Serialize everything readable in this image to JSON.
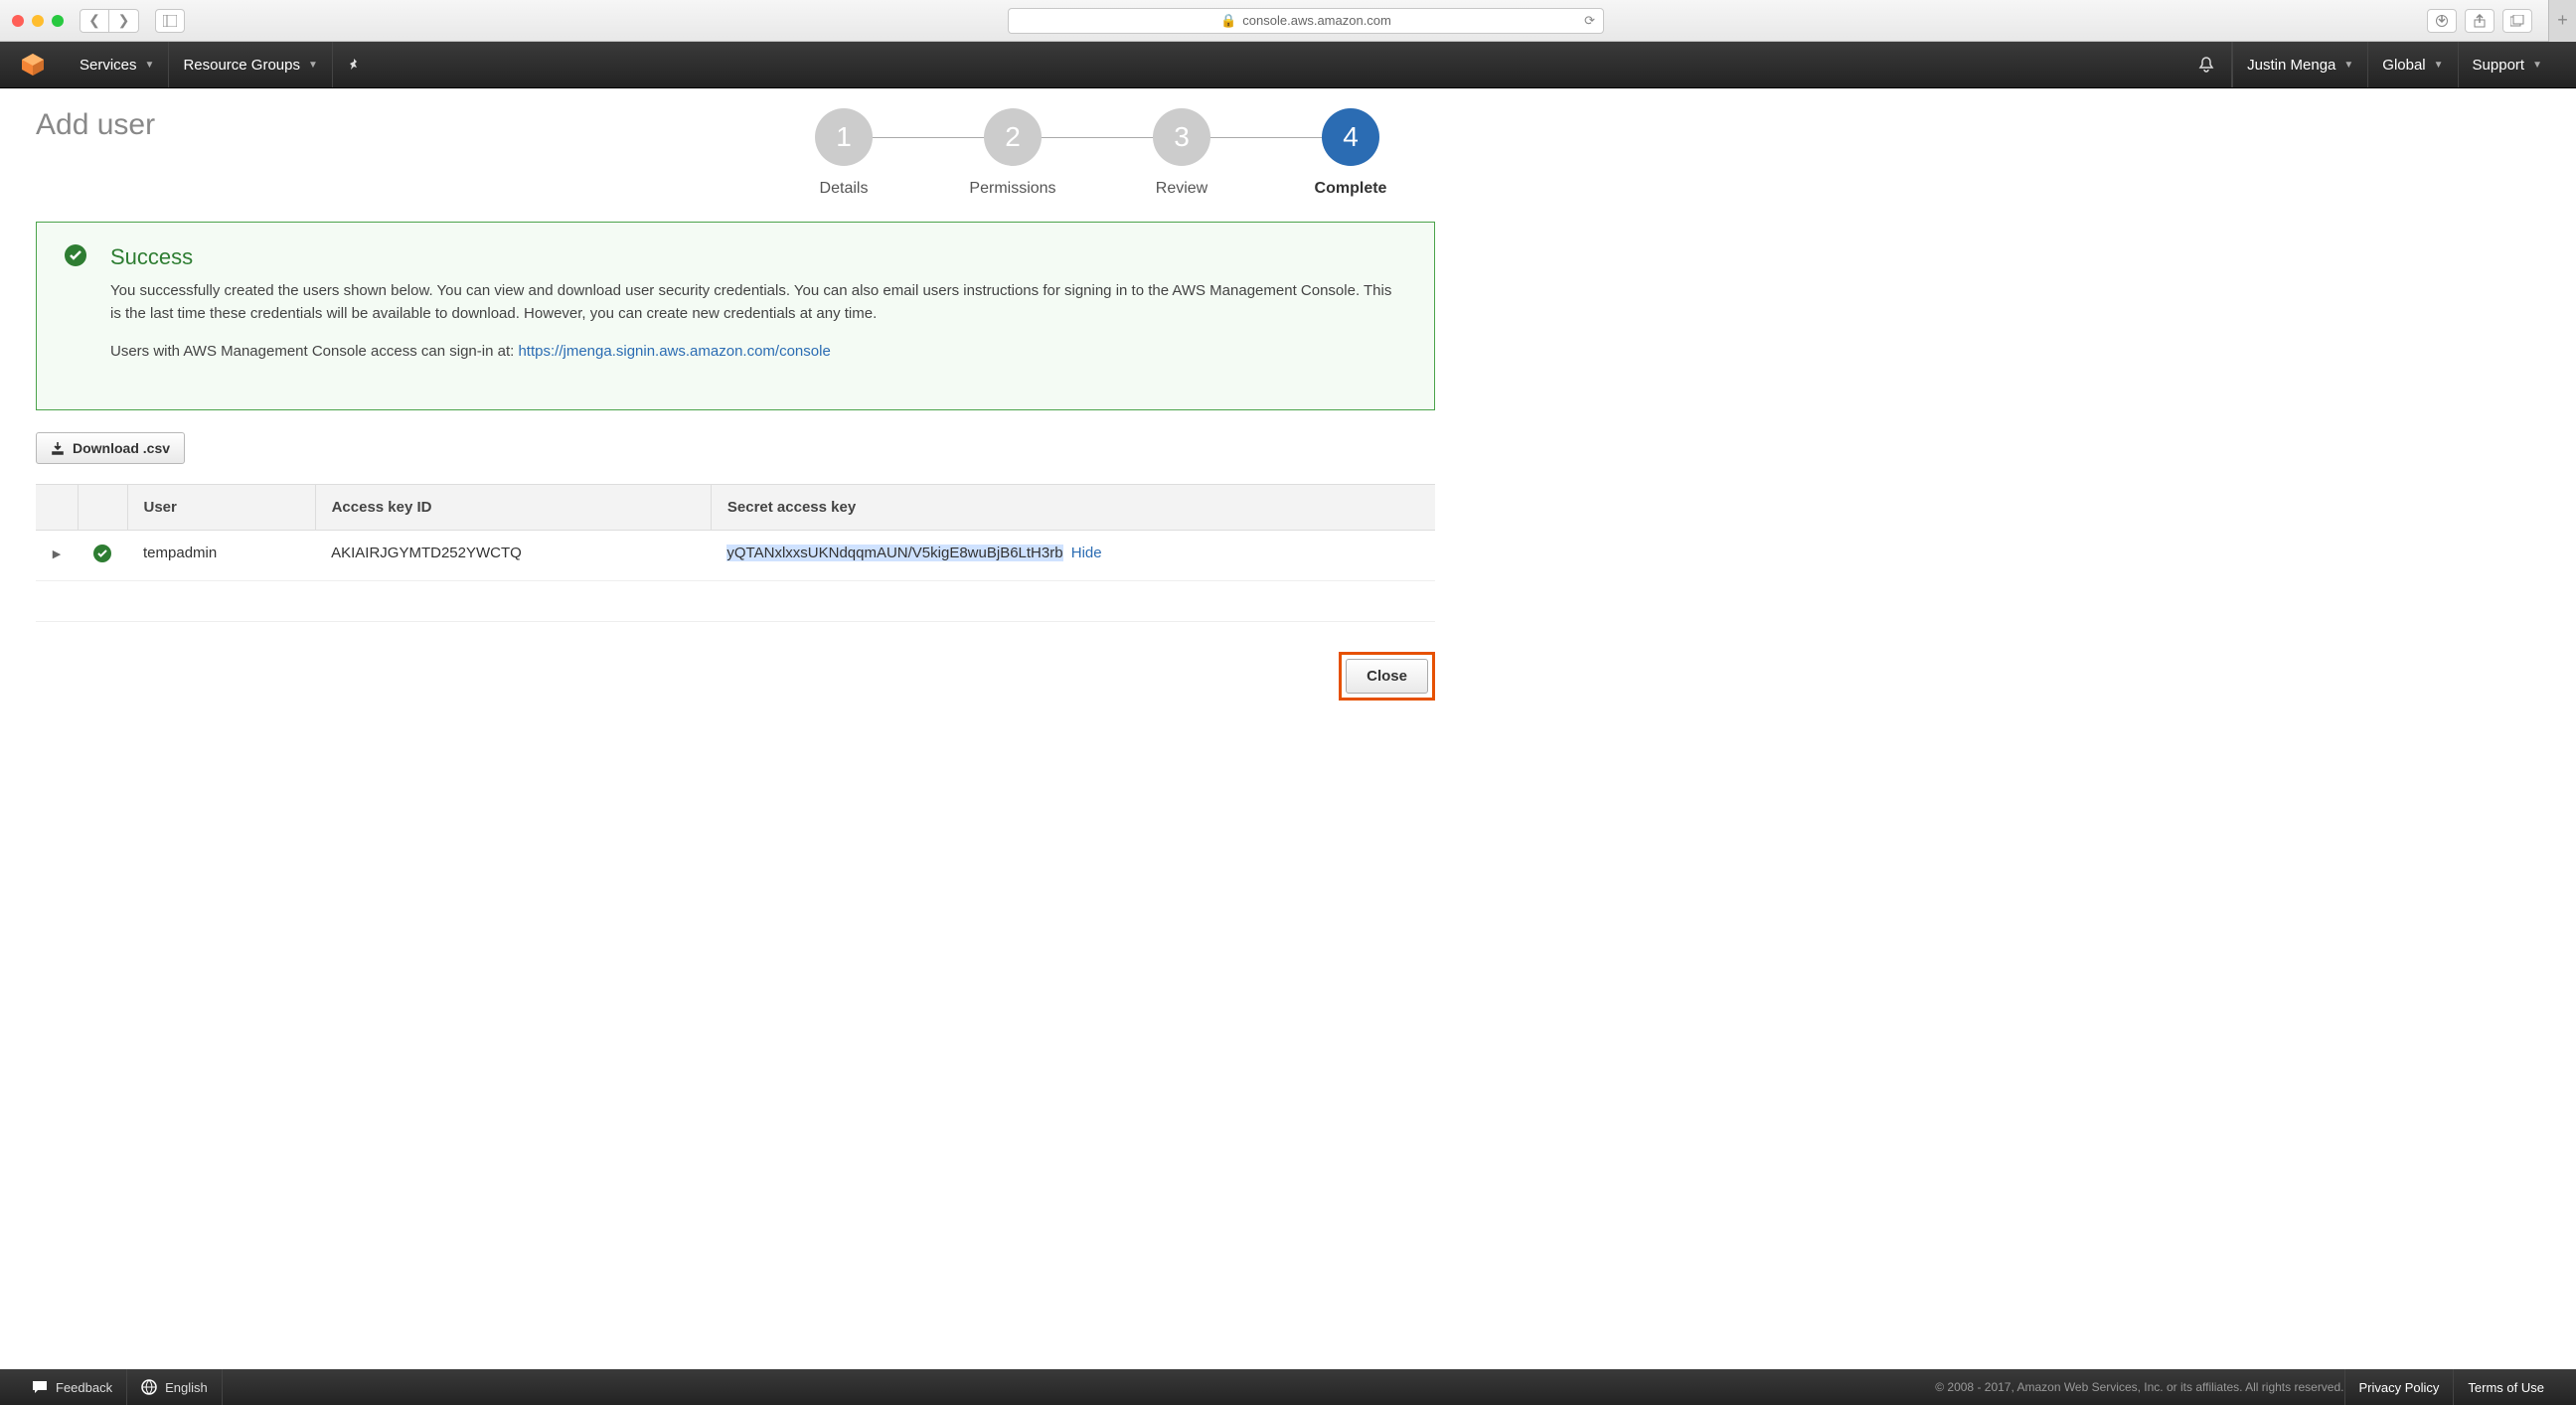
{
  "browser": {
    "url": "console.aws.amazon.com"
  },
  "nav": {
    "services": "Services",
    "resource_groups": "Resource Groups",
    "user": "Justin Menga",
    "region": "Global",
    "support": "Support"
  },
  "page": {
    "title": "Add user",
    "steps": [
      {
        "num": "1",
        "label": "Details"
      },
      {
        "num": "2",
        "label": "Permissions"
      },
      {
        "num": "3",
        "label": "Review"
      },
      {
        "num": "4",
        "label": "Complete"
      }
    ],
    "active_step": 4
  },
  "success": {
    "heading": "Success",
    "body": "You successfully created the users shown below. You can view and download user security credentials. You can also email users instructions for signing in to the AWS Management Console. This is the last time these credentials will be available to download. However, you can create new credentials at any time.",
    "signin_prefix": "Users with AWS Management Console access can sign-in at: ",
    "signin_url": "https://jmenga.signin.aws.amazon.com/console"
  },
  "download_label": "Download .csv",
  "table": {
    "headers": {
      "user": "User",
      "akid": "Access key ID",
      "secret": "Secret access key"
    },
    "row": {
      "user": "tempadmin",
      "akid": "AKIAIRJGYMTD252YWCTQ",
      "secret": "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",
      "hide": "Hide"
    }
  },
  "close_label": "Close",
  "footer": {
    "feedback": "Feedback",
    "language": "English",
    "copyright": "© 2008 - 2017, Amazon Web Services, Inc. or its affiliates. All rights reserved.",
    "privacy": "Privacy Policy",
    "terms": "Terms of Use"
  }
}
